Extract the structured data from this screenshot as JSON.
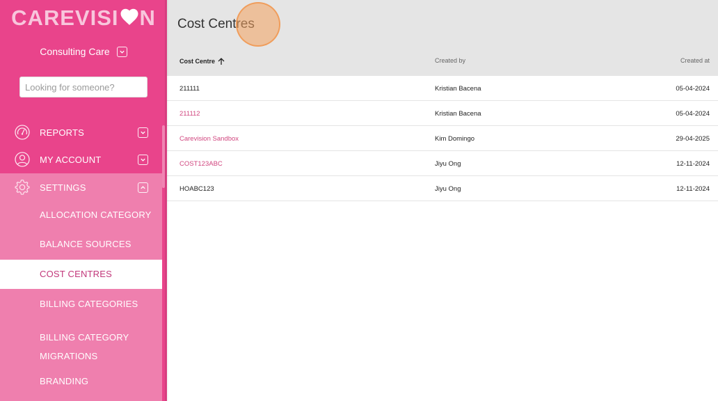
{
  "app": {
    "logo_text_left": "CAREVISI",
    "logo_text_right": "N"
  },
  "sidebar": {
    "org_name": "Consulting Care",
    "search_placeholder": "Looking for someone?",
    "nav": {
      "reports": "REPORTS",
      "my_account": "MY ACCOUNT",
      "settings": "SETTINGS"
    },
    "settings_items": [
      {
        "label": "ALLOCATION CATEGORY"
      },
      {
        "label": "BALANCE SOURCES"
      },
      {
        "label": "COST CENTRES",
        "active": true
      },
      {
        "label": "BILLING CATEGORIES"
      },
      {
        "label_line1": "BILLING CATEGORY",
        "label_line2": "MIGRATIONS"
      },
      {
        "label": "BRANDING"
      }
    ]
  },
  "main": {
    "title": "Cost Centres",
    "columns": {
      "cost_centre": "Cost Centre",
      "created_by": "Created by",
      "created_at": "Created at"
    },
    "sort": {
      "column": "Cost Centre",
      "direction": "ascending"
    },
    "rows": [
      {
        "cost_centre": "211111",
        "created_by": "Kristian Bacena",
        "created_at": "05-04-2024",
        "link": false
      },
      {
        "cost_centre": "211112",
        "created_by": "Kristian Bacena",
        "created_at": "05-04-2024",
        "link": true
      },
      {
        "cost_centre": "Carevision Sandbox",
        "created_by": "Kim Domingo",
        "created_at": "29-04-2025",
        "link": true
      },
      {
        "cost_centre": "COST123ABC",
        "created_by": "Jiyu Ong",
        "created_at": "12-11-2024",
        "link": true
      },
      {
        "cost_centre": "HOABC123",
        "created_by": "Jiyu Ong",
        "created_at": "12-11-2024",
        "link": false
      }
    ]
  },
  "colors": {
    "sidebar_bg": "#e9448b",
    "submenu_bg": "#ef7fae",
    "logo": "#f8c6dc",
    "link": "#d1467f",
    "active_text": "#c2377a",
    "header_bg": "#e5e5e5"
  },
  "icons": {
    "logo_heart": "heart-icon",
    "org_dropdown": "chevron-down-icon",
    "reports": "speedometer-icon",
    "my_account": "user-icon",
    "settings": "gear-icon",
    "sort": "arrow-up-icon"
  }
}
